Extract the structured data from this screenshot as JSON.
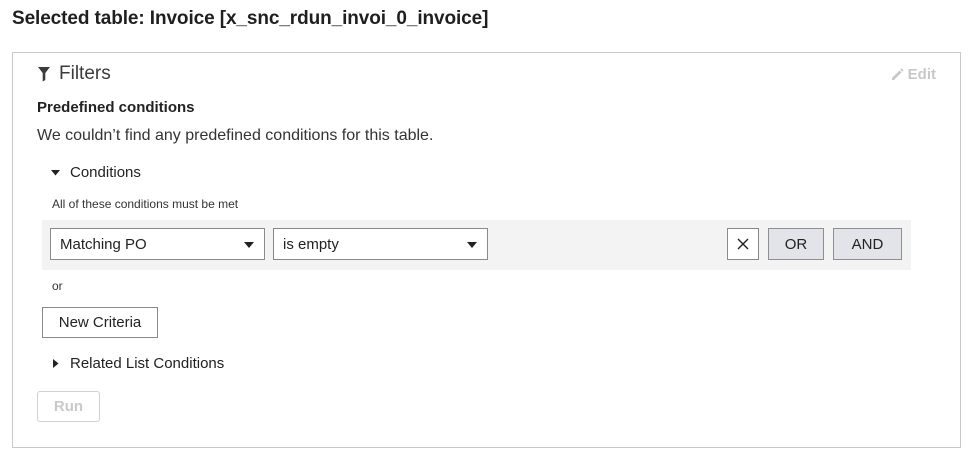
{
  "page": {
    "title": "Selected table: Invoice [x_snc_rdun_invoi_0_invoice]"
  },
  "filters": {
    "heading": "Filters",
    "heading_icon": "filter-icon",
    "edit_label": "Edit",
    "edit_icon": "pencil-icon",
    "predefined_title": "Predefined conditions",
    "predefined_message": "We couldn’t find any predefined conditions for this table."
  },
  "conditions": {
    "toggle_label": "Conditions",
    "expanded": true,
    "must_met_text": "All of these conditions must be met",
    "rows": [
      {
        "field": "Matching PO",
        "operator": "is empty",
        "remove_icon": "close-icon",
        "or_label": "OR",
        "and_label": "AND"
      }
    ],
    "or_separator": "or",
    "new_criteria_label": "New Criteria"
  },
  "related": {
    "toggle_label": "Related List Conditions",
    "expanded": false
  },
  "run": {
    "label": "Run",
    "enabled": false
  },
  "colors": {
    "accent_gray_button": "#e3e3ea",
    "row_background": "#f3f3f3",
    "disabled_text": "#c9c9c9"
  }
}
